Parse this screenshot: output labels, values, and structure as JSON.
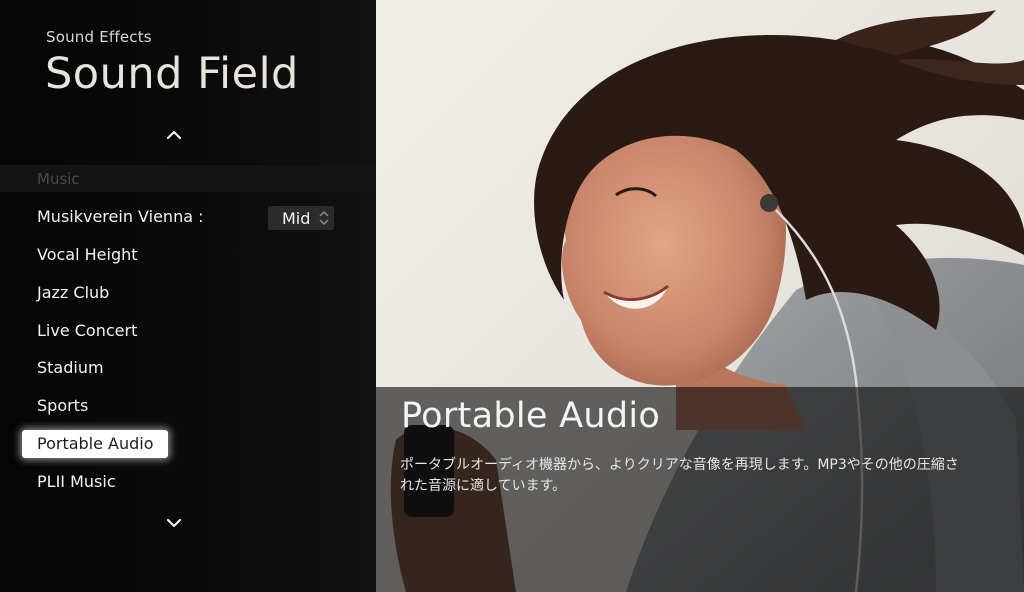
{
  "header": {
    "subtitle": "Sound Effects",
    "title": "Sound Field"
  },
  "menu": {
    "category": "Music",
    "items": [
      {
        "label": "Musikverein Vienna :"
      },
      {
        "label": "Vocal Height"
      },
      {
        "label": "Jazz Club"
      },
      {
        "label": "Live Concert"
      },
      {
        "label": "Stadium"
      },
      {
        "label": "Sports"
      },
      {
        "label": "Portable Audio",
        "selected": true
      },
      {
        "label": "PLII Music"
      }
    ],
    "musikverein_value": "Mid"
  },
  "preview": {
    "title": "Portable Audio",
    "description": "ポータブルオーディオ機器から、よりクリアな音像を再現します。MP3やその他の圧縮された音源に適しています。"
  },
  "icons": {
    "scroll_up": "chevron-up-icon",
    "scroll_down": "chevron-down-icon",
    "value_stepper": "updown-stepper-icon"
  }
}
